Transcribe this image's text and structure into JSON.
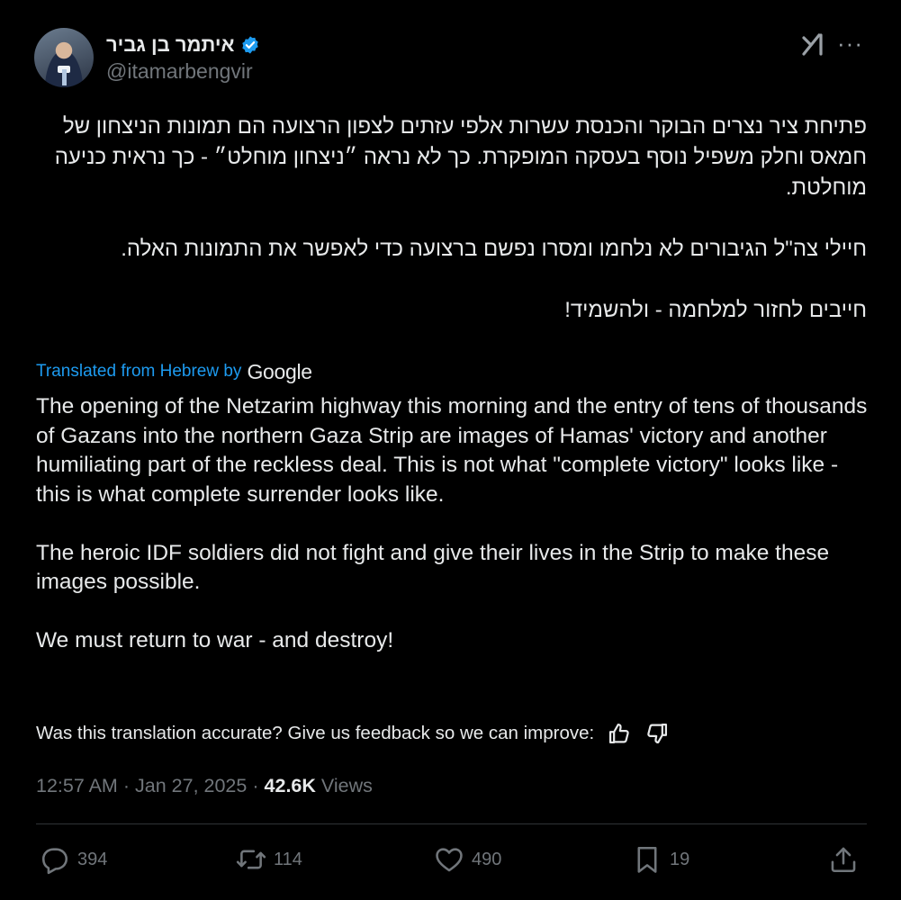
{
  "author": {
    "display_name": "איתמר בן גביר",
    "handle": "@itamarbengvir",
    "verified": true
  },
  "icons": {
    "verified": "verified-badge-icon",
    "grok": "grok-icon",
    "more": "more-icon",
    "reply": "reply-icon",
    "repost": "repost-icon",
    "like": "like-icon",
    "bookmark": "bookmark-icon",
    "share": "share-icon",
    "thumbs_up": "thumbs-up-icon",
    "thumbs_down": "thumbs-down-icon"
  },
  "colors": {
    "background": "#000000",
    "text": "#e7e9ea",
    "muted": "#71767b",
    "accent": "#1d9bf0",
    "divider": "#2f3336"
  },
  "tweet": {
    "hebrew_paragraphs": [
      "פתיחת ציר נצרים הבוקר והכנסת עשרות אלפי עזתים לצפון הרצועה הם תמונות הניצחון של חמאס וחלק משפיל נוסף בעסקה המופקרת. כך לא נראה ״ניצחון מוחלט״ - כך נראית כניעה מוחלטת.",
      "חיילי צה\"ל הגיבורים לא נלחמו ומסרו נפשם ברצועה כדי לאפשר את התמונות האלה.",
      "חייבים לחזור למלחמה - ולהשמיד!"
    ],
    "translated_label": "Translated from Hebrew by",
    "translated_provider": "Google",
    "english_paragraphs": [
      "The opening of the Netzarim highway this morning and the entry of tens of thousands of Gazans into the northern Gaza Strip are images of Hamas' victory and another humiliating part of the reckless deal. This is not what \"complete victory\" looks like - this is what complete surrender looks like.",
      "The heroic IDF soldiers did not fight and give their lives in the Strip to make these images possible.",
      "We must return to war - and destroy!"
    ],
    "feedback_prompt": "Was this translation accurate? Give us feedback so we can improve:",
    "time": "12:57 AM",
    "separator": "·",
    "date": "Jan 27, 2025",
    "views_count": "42.6K",
    "views_label": "Views"
  },
  "actions": {
    "replies": "394",
    "reposts": "114",
    "likes": "490",
    "bookmarks": "19"
  }
}
